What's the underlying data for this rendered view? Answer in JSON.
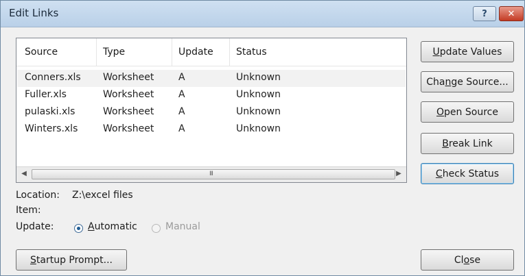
{
  "window": {
    "title": "Edit Links"
  },
  "titlebar": {
    "help_glyph": "?",
    "close_glyph": "✕"
  },
  "links_table": {
    "columns": [
      "Source",
      "Type",
      "Update",
      "Status"
    ],
    "rows": [
      {
        "source": "Conners.xls",
        "type": "Worksheet",
        "update": "A",
        "status": "Unknown",
        "selected": true
      },
      {
        "source": "Fuller.xls",
        "type": "Worksheet",
        "update": "A",
        "status": "Unknown"
      },
      {
        "source": "pulaski.xls",
        "type": "Worksheet",
        "update": "A",
        "status": "Unknown"
      },
      {
        "source": "Winters.xls",
        "type": "Worksheet",
        "update": "A",
        "status": "Unknown"
      }
    ],
    "scrollbar": {
      "left_arrow": "◀",
      "right_arrow": "▶",
      "grip": "III"
    }
  },
  "buttons": {
    "update_values": {
      "pre": "",
      "key": "U",
      "post": "pdate Values"
    },
    "change_source": {
      "pre": "Cha",
      "key": "n",
      "post": "ge Source..."
    },
    "open_source": {
      "pre": "",
      "key": "O",
      "post": "pen Source"
    },
    "break_link": {
      "pre": "",
      "key": "B",
      "post": "reak Link"
    },
    "check_status": {
      "pre": "",
      "key": "C",
      "post": "heck Status"
    },
    "startup_prompt": {
      "pre": "",
      "key": "S",
      "post": "tartup Prompt..."
    },
    "close": {
      "pre": "Cl",
      "key": "o",
      "post": "se"
    }
  },
  "details": {
    "location_label": "Location:",
    "location_value": "Z:\\excel files",
    "item_label": "Item:",
    "update_label": "Update:",
    "automatic": {
      "pre": "",
      "key": "A",
      "post": "utomatic",
      "checked": true
    },
    "manual": {
      "label": "Manual",
      "enabled": false
    }
  }
}
